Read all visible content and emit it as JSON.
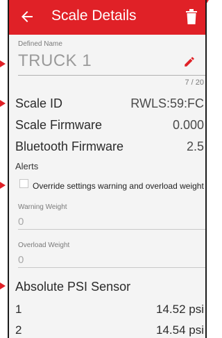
{
  "header": {
    "title": "Scale Details",
    "back_icon": "arrow-left-icon",
    "delete_icon": "trash-icon"
  },
  "defined_name": {
    "label": "Defined Name",
    "value": "TRUCK 1",
    "counter": "7 / 20",
    "edit_icon": "pencil-icon"
  },
  "scale_id": {
    "label": "Scale ID",
    "value": "RWLS:59:FC"
  },
  "scale_firmware": {
    "label": "Scale Firmware",
    "value": "0.000"
  },
  "bluetooth_firmware": {
    "label": "Bluetooth Firmware",
    "value": "2.5"
  },
  "alerts": {
    "heading": "Alerts",
    "override_label": "Override settings warning and overload weight",
    "override_checked": false,
    "warning_weight": {
      "label": "Warning Weight",
      "value": "0"
    },
    "overload_weight": {
      "label": "Overload Weight",
      "value": "0"
    }
  },
  "psi_sensor": {
    "title": "Absolute PSI Sensor",
    "rows": [
      {
        "name": "1",
        "value": "14.52 psi"
      },
      {
        "name": "2",
        "value": "14.54 psi"
      }
    ]
  },
  "colors": {
    "accent": "#e02127",
    "background": "#f4f4f4"
  }
}
